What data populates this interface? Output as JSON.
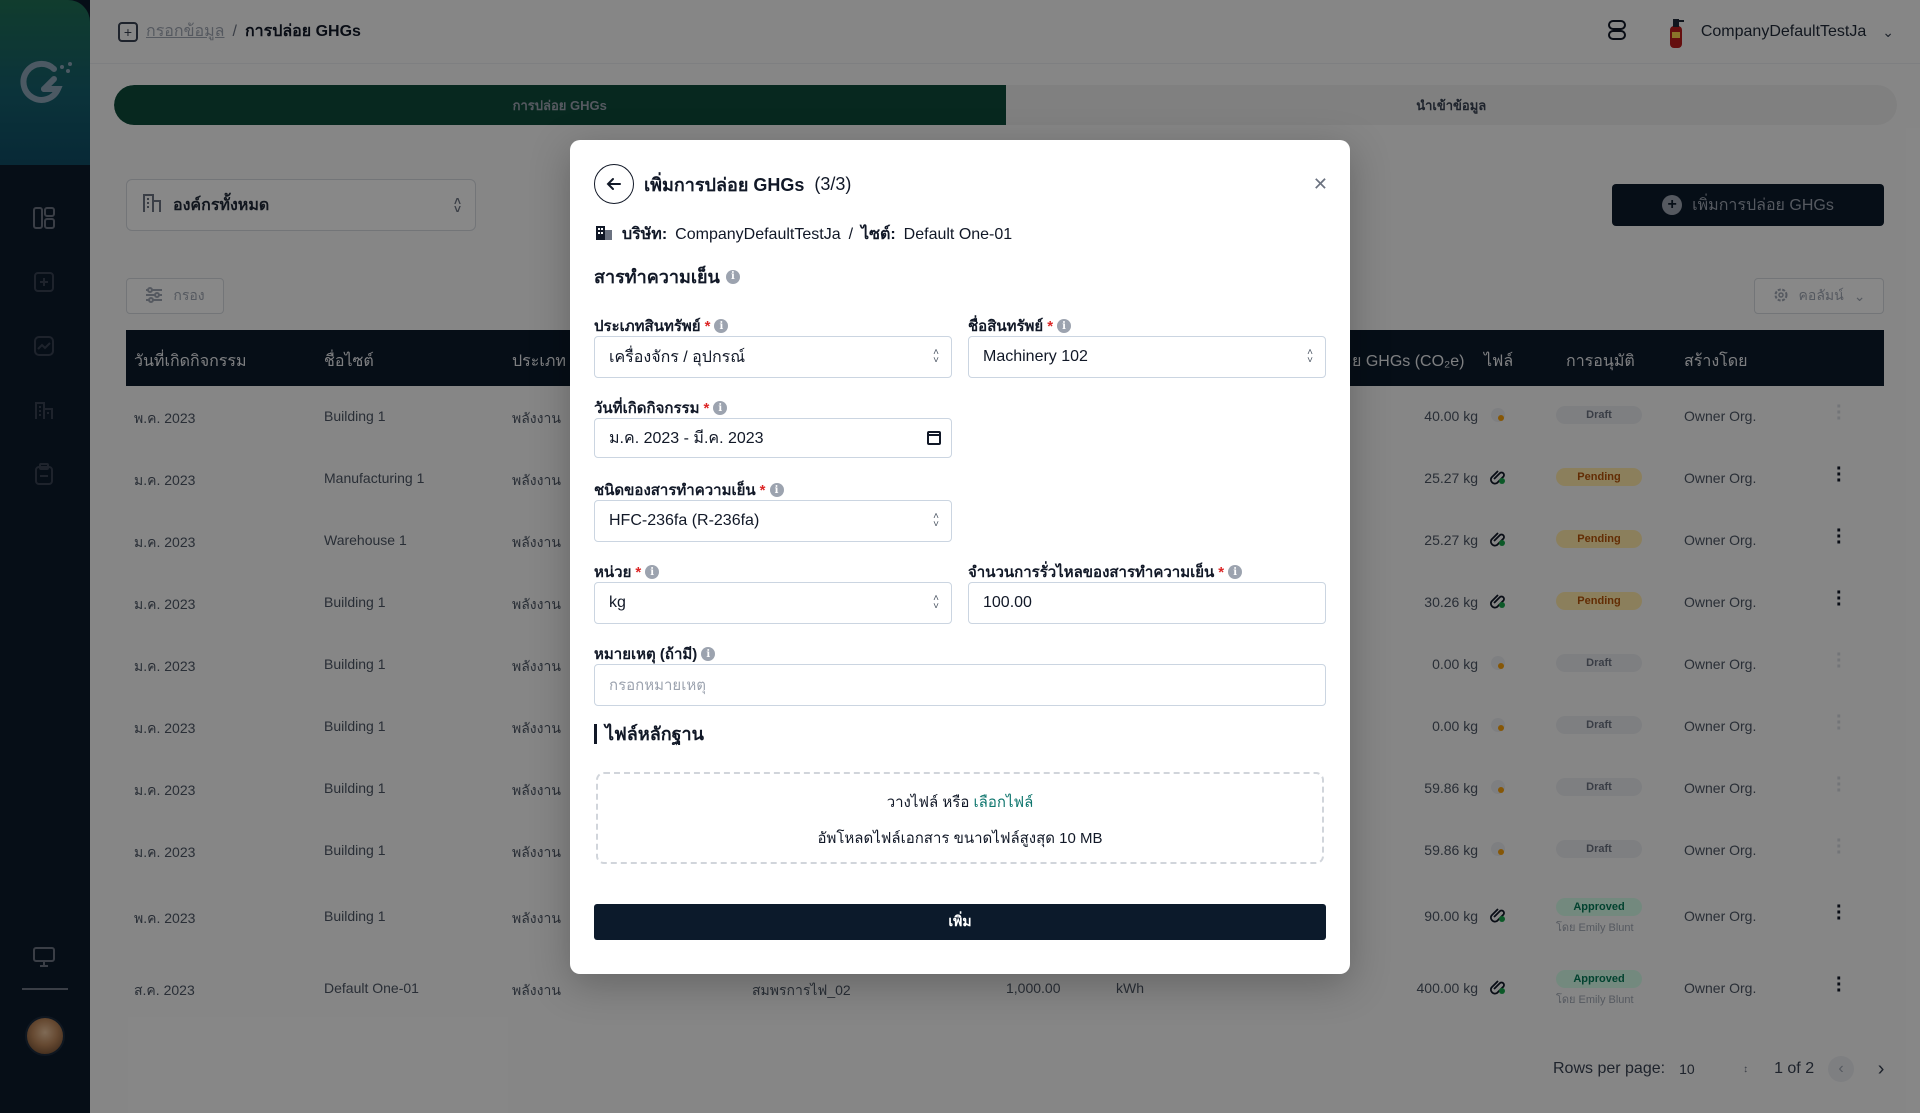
{
  "breadcrumb": {
    "parent": "กรอกข้อมูล",
    "separator": "/",
    "current": "การปล่อย GHGs"
  },
  "user": {
    "company": "CompanyDefaultTestJa"
  },
  "tabs": [
    {
      "label": "การปล่อย GHGs",
      "active": true
    },
    {
      "label": "นำเข้าข้อมูล",
      "active": false
    }
  ],
  "org_select": {
    "value": "องค์กรทั้งหมด"
  },
  "add_button": {
    "label": "เพิ่มการปล่อย GHGs"
  },
  "filter_button": {
    "label": "กรอง"
  },
  "columns_button": {
    "label": "คอลัมน์"
  },
  "table": {
    "headers": {
      "date": "วันที่เกิดกิจกรรม",
      "site": "ชื่อไซต์",
      "type": "ประเภท",
      "ghg": "ย GHGs (CO₂e)",
      "file": "ไฟล์",
      "approval": "การอนุมัติ",
      "created_by": "สร้างโดย"
    },
    "rows": [
      {
        "date": "พ.ค. 2023",
        "site": "Building 1",
        "type": "พลังงาน",
        "ghg": "40.00 kg",
        "status": "Draft",
        "approver": "",
        "created_by": "Owner Org."
      },
      {
        "date": "ม.ค. 2023",
        "site": "Manufacturing 1",
        "type": "พลังงาน",
        "ghg": "25.27 kg",
        "status": "Pending",
        "approver": "",
        "created_by": "Owner Org."
      },
      {
        "date": "ม.ค. 2023",
        "site": "Warehouse 1",
        "type": "พลังงาน",
        "ghg": "25.27 kg",
        "status": "Pending",
        "approver": "",
        "created_by": "Owner Org."
      },
      {
        "date": "ม.ค. 2023",
        "site": "Building 1",
        "type": "พลังงาน",
        "ghg": "30.26 kg",
        "status": "Pending",
        "approver": "",
        "created_by": "Owner Org."
      },
      {
        "date": "ม.ค. 2023",
        "site": "Building 1",
        "type": "พลังงาน",
        "ghg": "0.00 kg",
        "status": "Draft",
        "approver": "",
        "created_by": "Owner Org."
      },
      {
        "date": "ม.ค. 2023",
        "site": "Building 1",
        "type": "พลังงาน",
        "ghg": "0.00 kg",
        "status": "Draft",
        "approver": "",
        "created_by": "Owner Org."
      },
      {
        "date": "ม.ค. 2023",
        "site": "Building 1",
        "type": "พลังงาน",
        "ghg": "59.86 kg",
        "status": "Draft",
        "approver": "",
        "created_by": "Owner Org."
      },
      {
        "date": "ม.ค. 2023",
        "site": "Building 1",
        "type": "พลังงาน",
        "ghg": "59.86 kg",
        "status": "Draft",
        "approver": "",
        "created_by": "Owner Org."
      },
      {
        "date": "พ.ค. 2023",
        "site": "Building 1",
        "type": "พลังงาน",
        "ghg": "90.00 kg",
        "status": "Approved",
        "approver": "โดย Emily Blunt",
        "created_by": "Owner Org."
      },
      {
        "date": "ส.ค. 2023",
        "site": "Default One-01",
        "type": "พลังงาน",
        "asset": "สมพรการไฟ_02",
        "amount": "1,000.00",
        "unit": "kWh",
        "ghg": "400.00 kg",
        "status": "Approved",
        "approver": "โดย Emily Blunt",
        "created_by": "Owner Org."
      }
    ]
  },
  "pagination": {
    "rows_label": "Rows per page:",
    "rows_value": "10",
    "range": "1 of 2"
  },
  "modal": {
    "title": "เพิ่มการปล่อย GHGs",
    "step": "(3/3)",
    "company_label": "บริษัท:",
    "company_value": "CompanyDefaultTestJa",
    "separator": "/",
    "site_label": "ไซต์:",
    "site_value": "Default One-01",
    "section_title": "สารทำความเย็น",
    "asset_type": {
      "label": "ประเภทสินทรัพย์",
      "value": "เครื่องจักร / อุปกรณ์"
    },
    "asset_name": {
      "label": "ชื่อสินทรัพย์",
      "value": "Machinery 102"
    },
    "activity_date": {
      "label": "วันที่เกิดกิจกรรม",
      "value": "ม.ค. 2023 - มี.ค. 2023"
    },
    "refrigerant_type": {
      "label": "ชนิดของสารทำความเย็น",
      "value": "HFC-236fa (R-236fa)"
    },
    "unit": {
      "label": "หน่วย",
      "value": "kg"
    },
    "leak_amount": {
      "label": "จำนวนการรั่วไหลของสารทำความเย็น",
      "value": "100.00"
    },
    "note": {
      "label": "หมายเหตุ (ถ้ามี)",
      "placeholder": "กรอกหมายเหตุ"
    },
    "evidence_title": "ไฟล์หลักฐาน",
    "dropzone": {
      "text": "วางไฟล์ หรือ",
      "link": "เลือกไฟล์",
      "hint": "อัพโหลดไฟล์เอกสาร ขนาดไฟล์สูงสุด 10 MB"
    },
    "submit_label": "เพิ่ม",
    "required_mark": "*"
  }
}
